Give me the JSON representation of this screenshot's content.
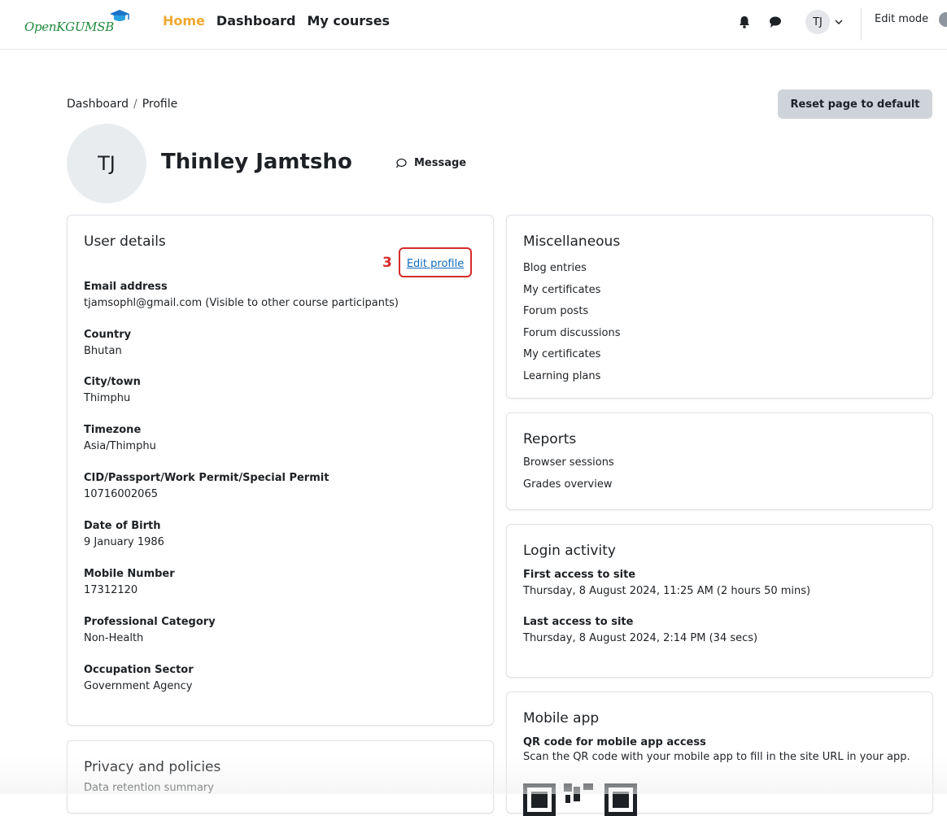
{
  "navbar": {
    "logo_text": "OpenKGUMSB",
    "links": [
      "Home",
      "Dashboard",
      "My courses"
    ],
    "user_initials": "TJ",
    "edit_mode_label": "Edit mode"
  },
  "breadcrumb": [
    "Dashboard",
    "Profile"
  ],
  "reset_button": "Reset page to default",
  "profile": {
    "initials": "TJ",
    "name": "Thinley Jamtsho",
    "message_label": "Message"
  },
  "user_details": {
    "title": "User details",
    "step_marker": "3",
    "edit_profile_label": "Edit profile",
    "fields": [
      {
        "label": "Email address",
        "value": "tjamsophl@gmail.com (Visible to other course participants)"
      },
      {
        "label": "Country",
        "value": "Bhutan"
      },
      {
        "label": "City/town",
        "value": "Thimphu"
      },
      {
        "label": "Timezone",
        "value": "Asia/Thimphu"
      },
      {
        "label": "CID/Passport/Work Permit/Special Permit",
        "value": "10716002065"
      },
      {
        "label": "Date of Birth",
        "value": "9 January 1986"
      },
      {
        "label": "Mobile Number",
        "value": "17312120"
      },
      {
        "label": "Professional Category",
        "value": "Non-Health"
      },
      {
        "label": "Occupation Sector",
        "value": "Government Agency"
      }
    ]
  },
  "privacy": {
    "title": "Privacy and policies",
    "items": [
      "Data retention summary"
    ]
  },
  "miscellaneous": {
    "title": "Miscellaneous",
    "items": [
      "Blog entries",
      "My certificates",
      "Forum posts",
      "Forum discussions",
      "My certificates",
      "Learning plans"
    ]
  },
  "reports": {
    "title": "Reports",
    "items": [
      "Browser sessions",
      "Grades overview"
    ]
  },
  "login_activity": {
    "title": "Login activity",
    "first_label": "First access to site",
    "first_value": "Thursday, 8 August 2024, 11:25 AM  (2 hours 50 mins)",
    "last_label": "Last access to site",
    "last_value": "Thursday, 8 August 2024, 2:14 PM  (34 secs)"
  },
  "mobile_app": {
    "title": "Mobile app",
    "qr_label": "QR code for mobile app access",
    "qr_text": "Scan the QR code with your mobile app to fill in the site URL in your app."
  }
}
